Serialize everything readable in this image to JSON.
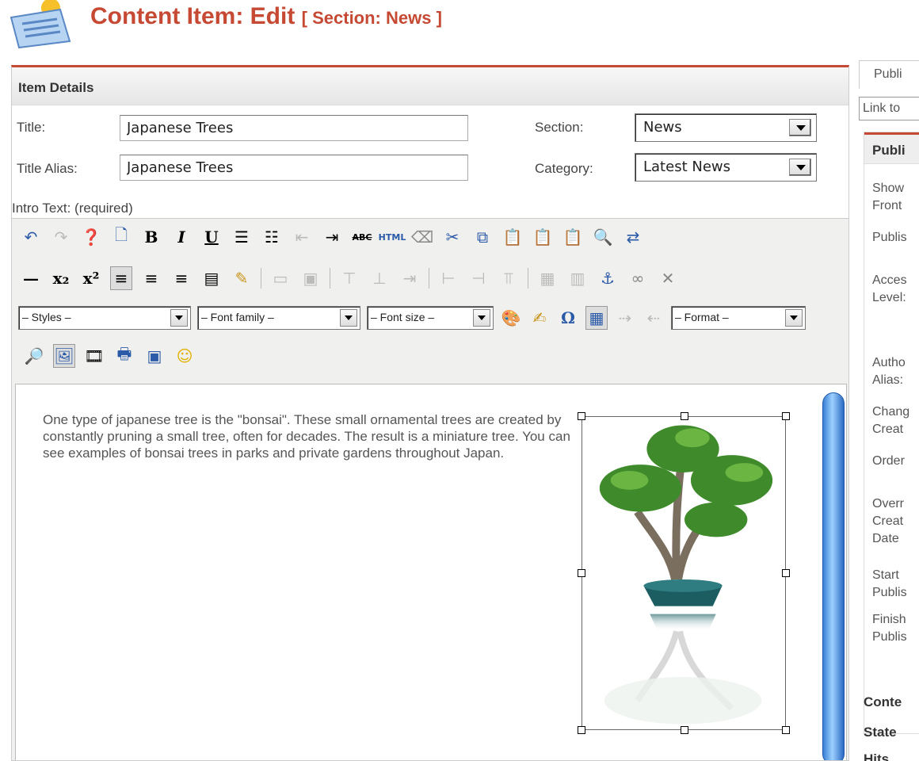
{
  "header": {
    "title": "Content Item: Edit",
    "section": "[ Section: News ]"
  },
  "details": {
    "heading": "Item Details",
    "title_label": "Title:",
    "title_value": "Japanese Trees",
    "alias_label": "Title Alias:",
    "alias_value": "Japanese Trees",
    "section_label": "Section:",
    "section_value": "News",
    "category_label": "Category:",
    "category_value": "Latest News",
    "intro_label": "Intro Text: (required)"
  },
  "editor": {
    "styles": "– Styles –",
    "font_family": "– Font family –",
    "font_size": "– Font size –",
    "format": "– Format –",
    "body_text": "One type of japanese tree is the \"bonsai\". These small ornamental trees are created by constantly pruning a small tree, often for decades. The result is a miniature tree. You can see examples of bonsai trees in parks and private gardens throughout Japan."
  },
  "right": {
    "tab": "Publi",
    "link": "Link to",
    "box_heading": "Publi",
    "items": [
      "Show",
      "Front",
      "Publis",
      "Acces",
      "Level:",
      "Autho",
      "Alias:",
      "Chang",
      "Creat",
      "Order",
      "Overr",
      "Creat",
      "Date",
      "Start",
      "Publis",
      "Finish",
      "Publis"
    ],
    "content_heading": "Conte",
    "state": "State",
    "hits": "Hits"
  }
}
